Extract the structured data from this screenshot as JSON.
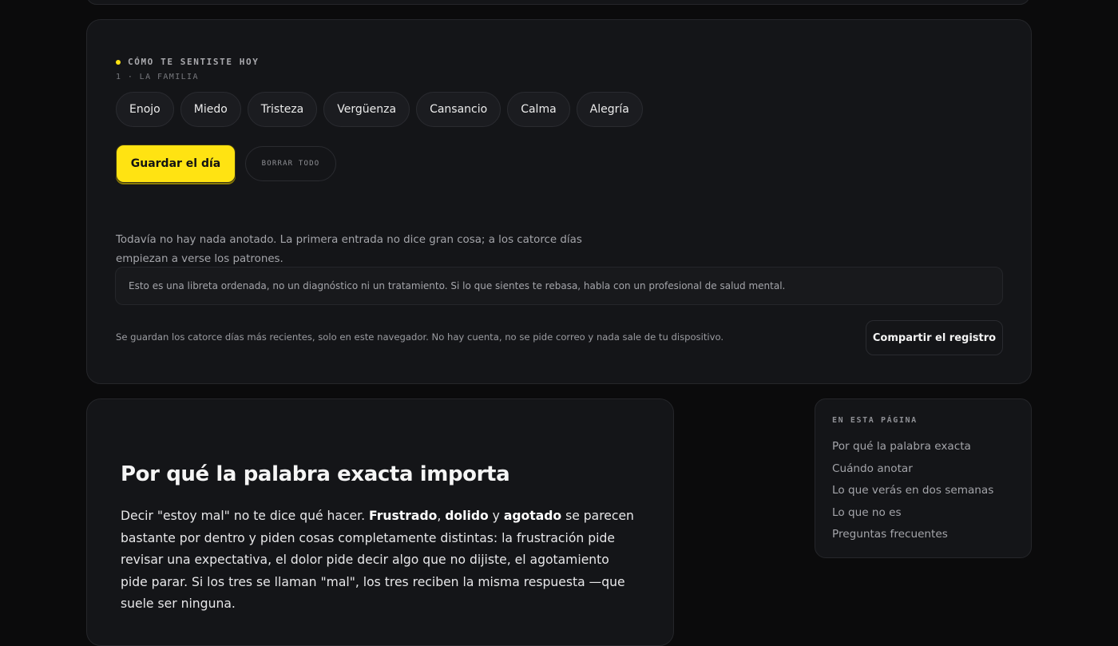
{
  "tracker": {
    "section_label": "CÓMO TE SENTISTE HOY",
    "section_sub": "1 · LA FAMILIA",
    "emotions": [
      "Enojo",
      "Miedo",
      "Tristeza",
      "Vergüenza",
      "Cansancio",
      "Calma",
      "Alegría"
    ],
    "save_label": "Guardar el día",
    "clear_label": "BORRAR TODO",
    "empty_note": "Todavía no hay nada anotado. La primera entrada no dice gran cosa; a los catorce días empiezan a verse los patrones.",
    "disclaimer": "Esto es una libreta ordenada, no un diagnóstico ni un tratamiento. Si lo que sientes te rebasa, habla con un profesional de salud mental.",
    "privacy": "Se guardan los catorce días más recientes, solo en este navegador. No hay cuenta, no se pide correo y nada sale de tu dispositivo.",
    "share_label": "Compartir el registro"
  },
  "article": {
    "title": "Por qué la palabra exacta importa",
    "p_intro": "Decir \"estoy mal\" no te dice qué hacer. ",
    "b1": "Frustrado",
    "sep1": ", ",
    "b2": "dolido",
    "sep2": " y ",
    "b3": "agotado",
    "p_rest": " se parecen bastante por dentro y piden cosas completamente distintas: la frustración pide revisar una expectativa, el dolor pide decir algo que no dijiste, el agotamiento pide parar. Si los tres se llaman \"mal\", los tres reciben la misma respuesta —que suele ser ninguna."
  },
  "toc": {
    "title": "EN ESTA PÁGINA",
    "items": [
      "Por qué la palabra exacta",
      "Cuándo anotar",
      "Lo que verás en dos semanas",
      "Lo que no es",
      "Preguntas frecuentes"
    ]
  },
  "colors": {
    "accent": "#ffe312",
    "background": "#0b0b0c",
    "card": "#141518"
  }
}
